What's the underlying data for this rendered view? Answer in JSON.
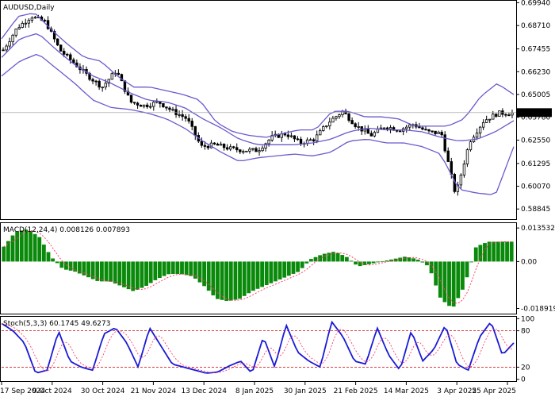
{
  "colors": {
    "background": "#ffffff",
    "candle": "#000000",
    "bollinger": "#6a5acd",
    "macd_hist": "#0a8a0a",
    "macd_signal": "#ff3c6e",
    "stoch_main": "#1a1ad6",
    "stoch_signal": "#ff3c6e",
    "level_line": "#d22222",
    "last_price_bg": "#000000",
    "last_price_fg": "#ffffff"
  },
  "chart_data": [
    {
      "type": "candlestick",
      "title": "AUDUSD,Daily",
      "ylim": [
        0.583,
        0.7
      ],
      "y_ticks": [
        "0.69940",
        "0.68710",
        "0.67455",
        "0.66230",
        "0.65005",
        "0.63780",
        "0.62550",
        "0.61295",
        "0.60070",
        "0.58845"
      ],
      "last_price": "0.64029",
      "x_labels": [
        "17 Sep 2024",
        "9 Oct 2024",
        "30 Oct 2024",
        "21 Nov 2024",
        "13 Dec 2024",
        "8 Jan 2025",
        "30 Jan 2025",
        "21 Feb 2025",
        "14 Mar 2025",
        "3 Apr 2025",
        "25 Apr 2025"
      ],
      "close_anchors": [
        0.674,
        0.686,
        0.692,
        0.689,
        0.674,
        0.667,
        0.66,
        0.654,
        0.663,
        0.646,
        0.644,
        0.646,
        0.641,
        0.637,
        0.622,
        0.623,
        0.621,
        0.62,
        0.62,
        0.627,
        0.629,
        0.624,
        0.626,
        0.635,
        0.641,
        0.633,
        0.628,
        0.633,
        0.631,
        0.634,
        0.63,
        0.629,
        0.596,
        0.625,
        0.636,
        0.64,
        0.64
      ],
      "bollinger_upper_anchors": [
        0.68,
        0.692,
        0.694,
        0.685,
        0.677,
        0.67,
        0.668,
        0.66,
        0.654,
        0.654,
        0.652,
        0.65,
        0.647,
        0.635,
        0.63,
        0.628,
        0.627,
        0.629,
        0.631,
        0.631,
        0.641,
        0.641,
        0.638,
        0.638,
        0.637,
        0.633,
        0.633,
        0.633,
        0.637,
        0.649,
        0.656,
        0.65
      ],
      "bollinger_middle_anchors": [
        0.67,
        0.68,
        0.683,
        0.674,
        0.666,
        0.66,
        0.656,
        0.651,
        0.647,
        0.646,
        0.643,
        0.637,
        0.632,
        0.626,
        0.623,
        0.623,
        0.623,
        0.624,
        0.626,
        0.63,
        0.632,
        0.631,
        0.631,
        0.63,
        0.627,
        0.625,
        0.626,
        0.63,
        0.636
      ],
      "bollinger_lower_anchors": [
        0.66,
        0.668,
        0.672,
        0.664,
        0.656,
        0.647,
        0.643,
        0.642,
        0.64,
        0.637,
        0.632,
        0.625,
        0.619,
        0.614,
        0.616,
        0.617,
        0.618,
        0.617,
        0.619,
        0.625,
        0.626,
        0.624,
        0.624,
        0.622,
        0.618,
        0.599,
        0.597,
        0.596,
        0.622
      ]
    },
    {
      "type": "bar",
      "title": "MACD(12,24,4) 0.008126 0.007893",
      "ylim": [
        -0.021,
        0.0155
      ],
      "y_ticks": [
        "0.013532",
        "0.00",
        "-0.018919"
      ],
      "histogram_anchors": [
        0.006,
        0.012,
        0.013,
        0.01,
        0.002,
        -0.003,
        -0.004,
        -0.006,
        -0.008,
        -0.008,
        -0.01,
        -0.012,
        -0.01,
        -0.007,
        -0.005,
        -0.005,
        -0.006,
        -0.01,
        -0.015,
        -0.016,
        -0.015,
        -0.012,
        -0.01,
        -0.008,
        -0.006,
        -0.004,
        0.001,
        0.003,
        0.004,
        0.002,
        -0.002,
        -0.001,
        0.0,
        0.001,
        0.002,
        0.001,
        -0.002,
        -0.015,
        -0.019,
        -0.01,
        0.006,
        0.008,
        0.008,
        0.008
      ]
    },
    {
      "type": "line",
      "title": "Stoch(5,3,3) 60.1745 49.6273",
      "ylim": [
        0,
        100
      ],
      "y_ticks": [
        "100",
        "80",
        "20",
        "0"
      ],
      "levels": [
        80,
        20
      ],
      "k_anchors": [
        92,
        80,
        60,
        10,
        15,
        80,
        30,
        20,
        15,
        75,
        85,
        60,
        20,
        85,
        55,
        25,
        20,
        15,
        10,
        12,
        22,
        30,
        10,
        70,
        20,
        90,
        45,
        30,
        20,
        95,
        70,
        30,
        25,
        85,
        40,
        15,
        80,
        30,
        50,
        90,
        25,
        15,
        70,
        95,
        40,
        60
      ]
    }
  ]
}
